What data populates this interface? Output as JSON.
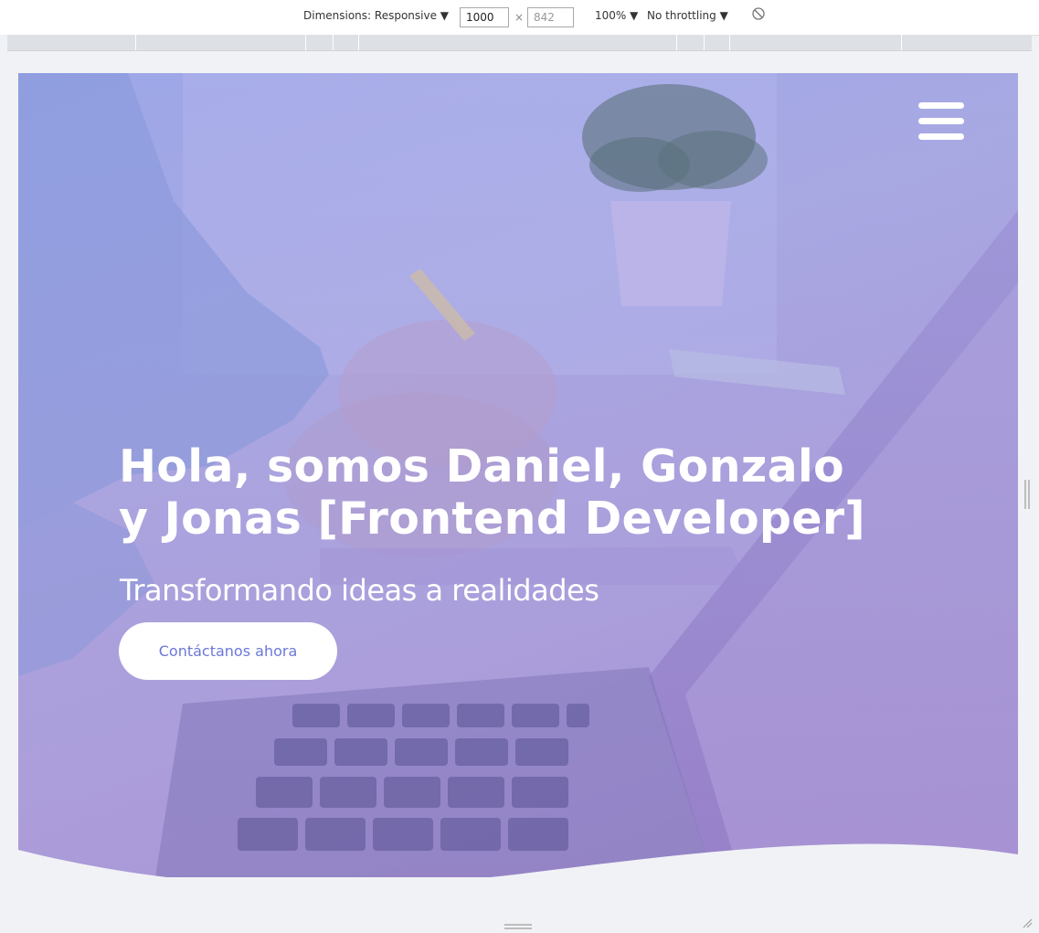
{
  "devtools": {
    "dimensions_label": "Dimensions: Responsive ▼",
    "width_value": "1000",
    "times_symbol": "×",
    "height_value": "842",
    "zoom_label": "100% ▼",
    "throttling_label": "No throttling ▼",
    "rotate_icon_glyph": "⃠"
  },
  "hero": {
    "title_line1": "Hola, somos Daniel, Gonzalo",
    "title_line2": "y Jonas [Frontend Developer]",
    "subtitle": "Transformando ideas a realidades",
    "cta_label": "Contáctanos ahora"
  },
  "colors": {
    "overlay_start": "#a9b3eb",
    "overlay_end": "#a48ccd",
    "cta_text": "#6b78d8",
    "page_bg": "#f1f2f5"
  },
  "icons": {
    "menu": "hamburger-menu-icon",
    "rotate": "rotate-icon"
  }
}
